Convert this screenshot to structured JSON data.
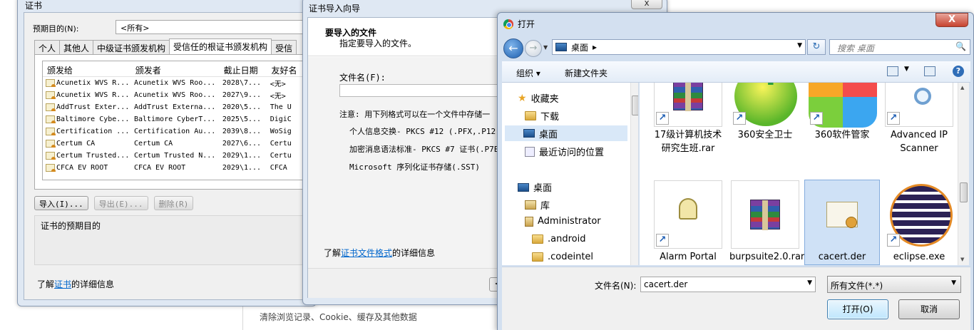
{
  "background": {
    "clear_data_text": "清除浏览记录、Cookie、缓存及其他数据"
  },
  "cert_dialog": {
    "title": "证书",
    "purpose_label": "预期目的(N):",
    "purpose_value": "<所有>",
    "tabs": [
      "个人",
      "其他人",
      "中级证书颁发机构",
      "受信任的根证书颁发机构",
      "受信"
    ],
    "columns": [
      "颁发给",
      "颁发者",
      "截止日期",
      "友好名"
    ],
    "rows": [
      [
        "Acunetix WVS R...",
        "Acunetix WVS Roo...",
        "2028\\7...",
        "<无>"
      ],
      [
        "Acunetix WVS R...",
        "Acunetix WVS Roo...",
        "2027\\9...",
        "<无>"
      ],
      [
        "AddTrust Exter...",
        "AddTrust Externa...",
        "2020\\5...",
        "The U"
      ],
      [
        "Baltimore Cybe...",
        "Baltimore CyberT...",
        "2025\\5...",
        "DigiC"
      ],
      [
        "Certification ...",
        "Certification Au...",
        "2039\\8...",
        "WoSig"
      ],
      [
        "Certum CA",
        "Certum CA",
        "2027\\6...",
        "Certu"
      ],
      [
        "Certum Trusted...",
        "Certum Trusted N...",
        "2029\\1...",
        "Certu"
      ],
      [
        "CFCA EV ROOT",
        "CFCA EV ROOT",
        "2029\\1...",
        "CFCA"
      ]
    ],
    "import_btn": "导入(I)...",
    "export_btn": "导出(E)...",
    "remove_btn": "删除(R)",
    "purpose_box_label": "证书的预期目的",
    "more_prefix": "了解",
    "more_link": "证书",
    "more_suffix": "的详细信息"
  },
  "wizard": {
    "title": "证书导入向导",
    "close_glyph": "x",
    "heading": "要导入的文件",
    "subheading": "指定要导入的文件。",
    "filename_label": "文件名(F):",
    "filename_value": "",
    "note": "注意: 用下列格式可以在一个文件中存储一",
    "formats": [
      "个人信息交换- PKCS #12 (.PFX,.P12)",
      "加密消息语法标准- PKCS #7 证书(.P7E",
      "Microsoft 序列化证书存储(.SST)"
    ],
    "link_prefix": "了解",
    "link_text": "证书文件格式",
    "link_suffix": "的详细信息",
    "back_glyph": "<"
  },
  "open_dialog": {
    "title": "打开",
    "close_glyph": "X",
    "address": "桌面",
    "address_chevron": "▸",
    "search_placeholder": "搜索 桌面",
    "toolbar": {
      "organize": "组织 ▾",
      "new_folder": "新建文件夹"
    },
    "nav": [
      {
        "label": "收藏夹",
        "icon": "star-icon"
      },
      {
        "label": "下载",
        "icon": "folder-icon"
      },
      {
        "label": "桌面",
        "icon": "desktop-icon",
        "selected": true
      },
      {
        "label": "最近访问的位置",
        "icon": "recent-places-icon"
      },
      {
        "label": "桌面",
        "icon": "desktop-icon"
      },
      {
        "label": "库",
        "icon": "library-icon"
      },
      {
        "label": "Administrator",
        "icon": "user-folder-icon"
      },
      {
        "label": ".android",
        "icon": "folder-icon"
      },
      {
        "label": ".codeintel",
        "icon": "folder-icon"
      }
    ],
    "files": [
      {
        "label": "17级计算机技术研究生班.rar",
        "icon": "winrar-archive-icon",
        "shortcut": true
      },
      {
        "label": "360安全卫士",
        "icon": "360-safe-icon",
        "shortcut": true
      },
      {
        "label": "360软件管家",
        "icon": "360-software-manager-icon",
        "shortcut": true
      },
      {
        "label": "Advanced IP Scanner",
        "icon": "ip-scanner-icon",
        "shortcut": true
      },
      {
        "label": "Alarm Portal",
        "icon": "bell-icon",
        "shortcut": true
      },
      {
        "label": "burpsuite2.0.rar",
        "icon": "winrar-archive-icon",
        "shortcut": false
      },
      {
        "label": "cacert.der",
        "icon": "certificate-file-icon",
        "shortcut": false,
        "selected": true
      },
      {
        "label": "eclipse.exe",
        "icon": "eclipse-icon",
        "shortcut": true
      }
    ],
    "filename_label": "文件名(N):",
    "filename_value": "cacert.der",
    "filetype_value": "所有文件(*.*)",
    "open_btn": "打开(O)",
    "cancel_btn": "取消"
  }
}
